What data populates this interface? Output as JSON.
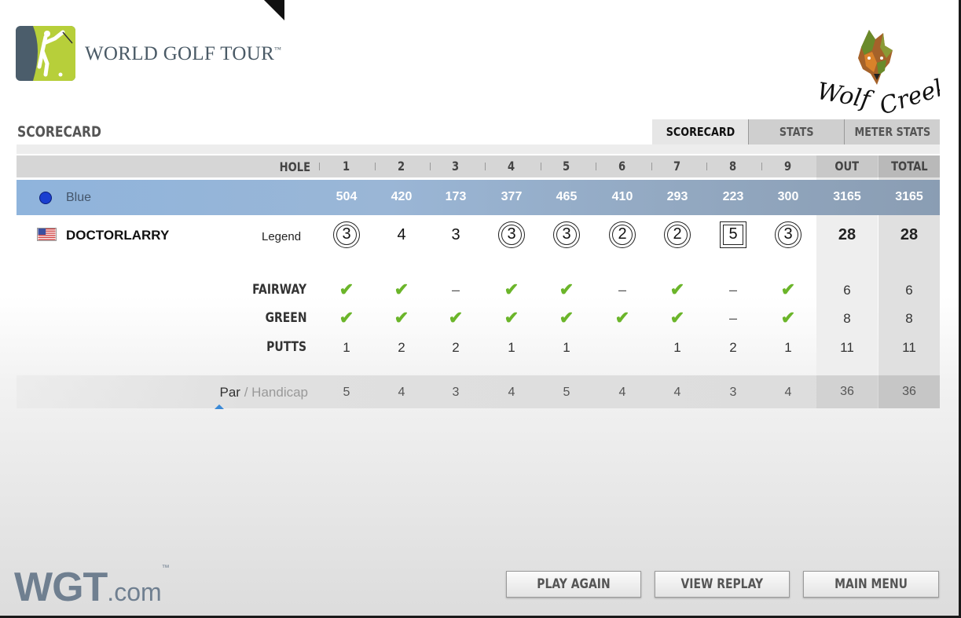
{
  "brand": {
    "title": "WORLD GOLF TOUR",
    "trademark": "™",
    "footer_main": "WGT",
    "footer_domain": ".com",
    "footer_tm": "™"
  },
  "course": {
    "logo_text": "Wolf Creek"
  },
  "section_title": "SCORECARD",
  "tabs": [
    {
      "label": "SCORECARD",
      "active": true
    },
    {
      "label": "STATS",
      "active": false
    },
    {
      "label": "METER STATS",
      "active": false
    }
  ],
  "header": {
    "hole_label": "HOLE",
    "holes": [
      "1",
      "2",
      "3",
      "4",
      "5",
      "6",
      "7",
      "8",
      "9"
    ],
    "out_label": "OUT",
    "total_label": "TOTAL"
  },
  "tee": {
    "name": "Blue",
    "color": "#1a3fd0",
    "yardages": [
      "504",
      "420",
      "173",
      "377",
      "465",
      "410",
      "293",
      "223",
      "300"
    ],
    "out": "3165",
    "total": "3165"
  },
  "player": {
    "name": "DOCTORLARRY",
    "level": "Legend",
    "flag": "us-flag",
    "scores": [
      {
        "value": "3",
        "mark": "circle"
      },
      {
        "value": "4",
        "mark": "none"
      },
      {
        "value": "3",
        "mark": "none"
      },
      {
        "value": "3",
        "mark": "circle"
      },
      {
        "value": "3",
        "mark": "circle"
      },
      {
        "value": "2",
        "mark": "circle"
      },
      {
        "value": "2",
        "mark": "circle"
      },
      {
        "value": "5",
        "mark": "square"
      },
      {
        "value": "3",
        "mark": "circle"
      }
    ],
    "out": "28",
    "total": "28"
  },
  "stats": {
    "fairway": {
      "label": "FAIRWAY",
      "values": [
        "check",
        "check",
        "dash",
        "check",
        "check",
        "dash",
        "check",
        "dash",
        "check"
      ],
      "out": "6",
      "total": "6"
    },
    "green": {
      "label": "GREEN",
      "values": [
        "check",
        "check",
        "check",
        "check",
        "check",
        "check",
        "check",
        "dash",
        "check"
      ],
      "out": "8",
      "total": "8"
    },
    "putts": {
      "label": "PUTTS",
      "values": [
        "1",
        "2",
        "2",
        "1",
        "1",
        "",
        "1",
        "2",
        "1"
      ],
      "out": "11",
      "total": "11"
    }
  },
  "symbols": {
    "check": "✔",
    "dash": "–"
  },
  "par": {
    "par_label": "Par",
    "slash": "/",
    "handicap_label": "Handicap",
    "values": [
      "5",
      "4",
      "3",
      "4",
      "5",
      "4",
      "4",
      "3",
      "4"
    ],
    "out": "36",
    "total": "36"
  },
  "buttons": {
    "play_again": "PLAY AGAIN",
    "view_replay": "VIEW REPLAY",
    "main_menu": "MAIN MENU"
  },
  "colors": {
    "check_green": "#6bb52a",
    "tee_band": "#8fb4dc",
    "pointer_blue": "#3a89d6"
  }
}
